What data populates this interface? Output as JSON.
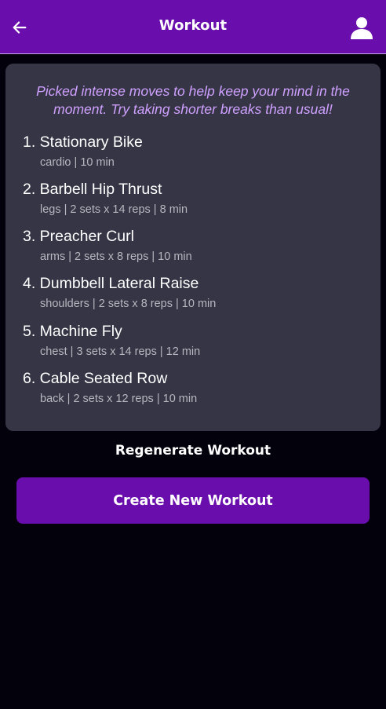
{
  "header": {
    "title": "Workout",
    "back_icon": "arrow-left-icon",
    "profile_icon": "user-icon"
  },
  "card": {
    "tagline": "Picked intense moves to help keep your mind in the moment. Try taking shorter breaks than usual!",
    "exercises": [
      {
        "name": "1. Stationary Bike",
        "detail": "cardio | 10 min"
      },
      {
        "name": "2. Barbell Hip Thrust",
        "detail": "legs | 2 sets x 14 reps | 8 min"
      },
      {
        "name": "3. Preacher Curl",
        "detail": "arms | 2 sets x 8 reps | 10 min"
      },
      {
        "name": "4. Dumbbell Lateral Raise",
        "detail": "shoulders | 2 sets x 8 reps | 10 min"
      },
      {
        "name": "5. Machine Fly",
        "detail": "chest | 3 sets x 14 reps | 12 min"
      },
      {
        "name": "6. Cable Seated Row",
        "detail": "back | 2 sets x 12 reps | 10 min"
      }
    ]
  },
  "actions": {
    "regenerate_label": "Regenerate Workout",
    "create_label": "Create New Workout"
  },
  "colors": {
    "accent": "#6a0dad",
    "background": "#03020c",
    "card": "#353545",
    "tagline": "#cfa0ff"
  }
}
